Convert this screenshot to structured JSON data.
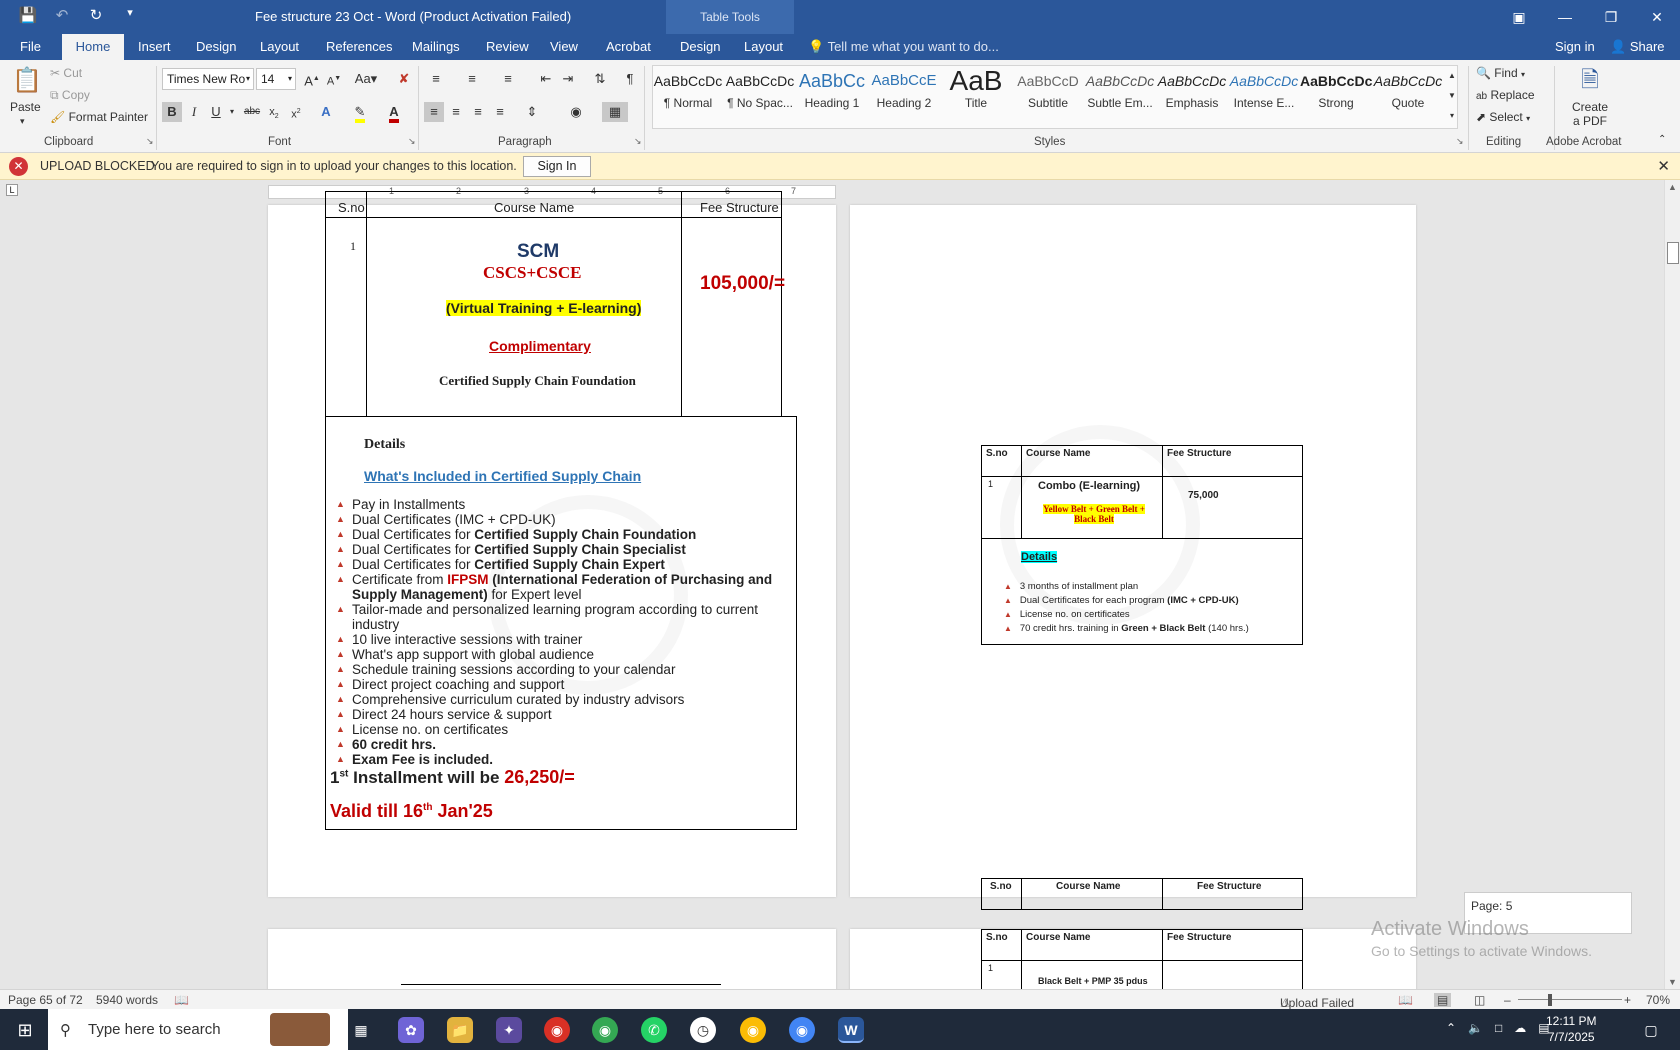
{
  "titlebar": {
    "title": "Fee structure 23 Oct - Word (Product Activation Failed)",
    "table_tools": "Table Tools",
    "save_icon": "save-icon",
    "undo_icon": "undo-icon",
    "redo_icon": "redo-icon"
  },
  "tabs": {
    "items": [
      "File",
      "Home",
      "Insert",
      "Design",
      "Layout",
      "References",
      "Mailings",
      "Review",
      "View",
      "Acrobat",
      "Design",
      "Layout"
    ],
    "active": "Home",
    "tell_me": "Tell me what you want to do...",
    "sign_in": "Sign in",
    "share": "Share"
  },
  "clipboard": {
    "paste": "Paste",
    "cut": "Cut",
    "copy": "Copy",
    "format_painter": "Format Painter",
    "label": "Clipboard"
  },
  "font": {
    "name": "Times New Ro",
    "size": "14",
    "label": "Font"
  },
  "paragraph": {
    "label": "Paragraph"
  },
  "styles": {
    "label": "Styles",
    "items": [
      {
        "sample": "AaBbCcDc",
        "name": "¶ Normal"
      },
      {
        "sample": "AaBbCcDc",
        "name": "¶ No Spac..."
      },
      {
        "sample": "AaBbCc",
        "name": "Heading 1"
      },
      {
        "sample": "AaBbCcE",
        "name": "Heading 2"
      },
      {
        "sample": "AaB",
        "name": "Title"
      },
      {
        "sample": "AaBbCcD",
        "name": "Subtitle"
      },
      {
        "sample": "AaBbCcDc",
        "name": "Subtle Em..."
      },
      {
        "sample": "AaBbCcDc",
        "name": "Emphasis"
      },
      {
        "sample": "AaBbCcDc",
        "name": "Intense E..."
      },
      {
        "sample": "AaBbCcDc",
        "name": "Strong"
      },
      {
        "sample": "AaBbCcDc",
        "name": "Quote"
      }
    ]
  },
  "editing": {
    "find": "Find",
    "replace": "Replace",
    "select": "Select",
    "label": "Editing"
  },
  "acrobat": {
    "create_pdf_1": "Create",
    "create_pdf_2": "a PDF",
    "label": "Adobe Acrobat"
  },
  "msgbar": {
    "title": "UPLOAD BLOCKED",
    "text": "You are required to sign in to upload your changes to this location.",
    "button": "Sign In"
  },
  "left_page": {
    "hdr_sno": "S.no",
    "hdr_course": "Course Name",
    "hdr_fee": "Fee Structure",
    "row_no": "1",
    "scm": "SCM",
    "cscs": "CSCS+CSCE",
    "virtual": "(Virtual Training + E-learning)",
    "complimentary": "Complimentary",
    "foundation": "Certified Supply Chain Foundation",
    "fee": "105,000/=",
    "details": "Details",
    "whats_included": "What's Included in Certified Supply Chain",
    "list": [
      {
        "pre": "Pay in Installments",
        "bold": "",
        "post": ""
      },
      {
        "pre": "Dual Certificates (IMC + CPD-UK)",
        "bold": "",
        "post": ""
      },
      {
        "pre": "Dual Certificates for ",
        "bold": "Certified Supply Chain Foundation",
        "post": ""
      },
      {
        "pre": "Dual Certificates for ",
        "bold": "Certified Supply Chain Specialist",
        "post": ""
      },
      {
        "pre": "Dual Certificates for ",
        "bold": "Certified Supply Chain Expert",
        "post": ""
      }
    ],
    "ifpsm_pre": "Certificate from ",
    "ifpsm_red": "IFPSM",
    "ifpsm_bold": " (International Federation of Purchasing and",
    "ifpsm_bold2": "Supply Management)",
    "ifpsm_post": " for Expert level",
    "tailor_1": "Tailor-made and personalized learning program according to current",
    "tailor_2": "industry",
    "list2": [
      "10 live interactive sessions with trainer",
      "What's app support with global audience",
      "Schedule training sessions according to your calendar",
      "Direct project coaching and support",
      "Comprehensive curriculum curated by industry advisors",
      "Direct 24 hours service & support",
      "License no. on certificates"
    ],
    "credit": "60 credit hrs.",
    "exam": "Exam Fee is included.",
    "inst_1": "1",
    "inst_sup": "st",
    "inst_2": " Installment will be ",
    "inst_amt": "26,250/=",
    "valid_1": "Valid till 16",
    "valid_sup": "th",
    "valid_2": " Jan'25"
  },
  "right_page": {
    "t1_sno": "S.no",
    "t1_course": "Course Name",
    "t1_fee": "Fee Structure",
    "t1_row": "1",
    "t1_combo": "Combo (E-learning)",
    "t1_belts_1": "Yellow Belt + Green Belt +",
    "t1_belts_2": "Black Belt",
    "t1_fee_val": "75,000",
    "t1_details": "Details",
    "t1_list": [
      {
        "pre": "3 months of installment plan",
        "bold": "",
        "post": ""
      },
      {
        "pre": "Dual Certificates for each program ",
        "bold": "(IMC + CPD-UK)",
        "post": ""
      },
      {
        "pre": "License no. on certificates",
        "bold": "",
        "post": ""
      },
      {
        "pre": "70 credit hrs. training in ",
        "bold": "Green + Black Belt",
        "post": " (140 hrs.)"
      }
    ],
    "t2_sno": "S.no",
    "t2_course": "Course Name",
    "t2_fee": "Fee Structure",
    "t3_sno": "S.no",
    "t3_course": "Course Name",
    "t3_fee": "Fee Structure",
    "t3_row": "1",
    "t3_course_val": "Black Belt + PMP 35 pdus"
  },
  "page_indicator": "Page: 5",
  "activate": {
    "line1": "Activate Windows",
    "line2": "Go to Settings to activate Windows."
  },
  "status": {
    "page": "Page 65 of 72",
    "words": "5940 words",
    "upload": "Upload Failed",
    "zoom": "70%"
  },
  "taskbar": {
    "search": "Type here to search",
    "time": "12:11 PM",
    "date": "7/7/2025"
  }
}
